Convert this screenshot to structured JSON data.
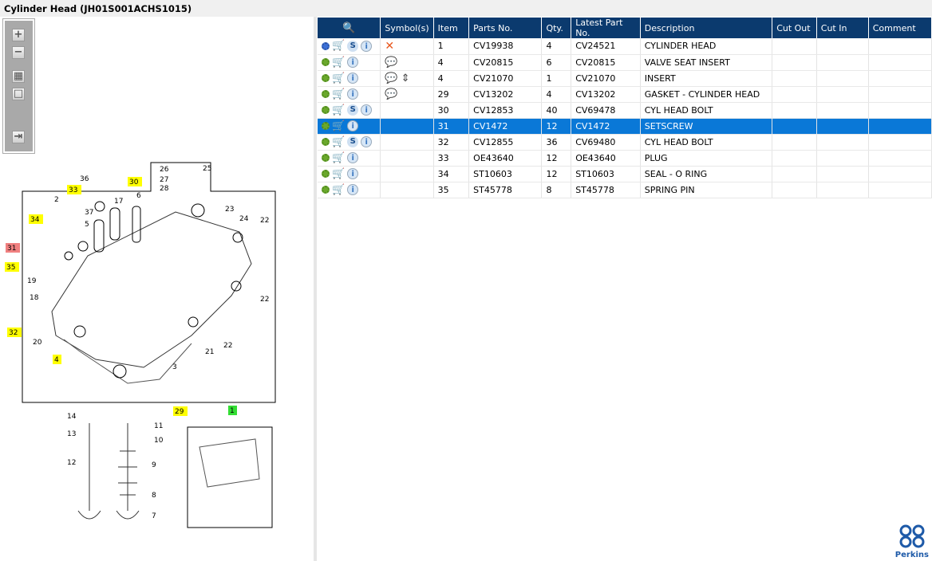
{
  "title": "Cylinder Head (JH01S001ACHS1015)",
  "toolbar": {
    "zoom_in": "+",
    "zoom_out": "−",
    "fit": "▦",
    "actual": "□",
    "export": "⇥"
  },
  "table": {
    "headers": [
      "",
      "Symbol(s)",
      "Item",
      "Parts No.",
      "Qty.",
      "Latest Part No.",
      "Description",
      "Cut Out",
      "Cut In",
      "Comment"
    ],
    "rows": [
      {
        "icons": [
          "gears-blue",
          "cart",
          "S",
          "i"
        ],
        "symbols": "✕",
        "item": "1",
        "part": "CV19938",
        "qty": "4",
        "latest": "CV24521",
        "desc": "CYLINDER HEAD",
        "sel": false
      },
      {
        "icons": [
          "gear",
          "cart",
          "i"
        ],
        "symbols": "💬",
        "item": "4",
        "part": "CV20815",
        "qty": "6",
        "latest": "CV20815",
        "desc": "VALVE SEAT INSERT",
        "sel": false
      },
      {
        "icons": [
          "gear",
          "cart",
          "i"
        ],
        "symbols": "💬 ⇕",
        "item": "4",
        "part": "CV21070",
        "qty": "1",
        "latest": "CV21070",
        "desc": "INSERT",
        "sel": false
      },
      {
        "icons": [
          "gear",
          "cart",
          "i"
        ],
        "symbols": "💬",
        "item": "29",
        "part": "CV13202",
        "qty": "4",
        "latest": "CV13202",
        "desc": "GASKET - CYLINDER HEAD",
        "sel": false
      },
      {
        "icons": [
          "gear",
          "cart",
          "S",
          "i"
        ],
        "symbols": "",
        "item": "30",
        "part": "CV12853",
        "qty": "40",
        "latest": "CV69478",
        "desc": "CYL HEAD BOLT",
        "sel": false
      },
      {
        "icons": [
          "gear",
          "cart",
          "i"
        ],
        "symbols": "",
        "item": "31",
        "part": "CV1472",
        "qty": "12",
        "latest": "CV1472",
        "desc": "SETSCREW",
        "sel": true
      },
      {
        "icons": [
          "gear",
          "cart",
          "S",
          "i"
        ],
        "symbols": "",
        "item": "32",
        "part": "CV12855",
        "qty": "36",
        "latest": "CV69480",
        "desc": "CYL HEAD BOLT",
        "sel": false
      },
      {
        "icons": [
          "gear",
          "cart",
          "i"
        ],
        "symbols": "",
        "item": "33",
        "part": "OE43640",
        "qty": "12",
        "latest": "OE43640",
        "desc": "PLUG",
        "sel": false
      },
      {
        "icons": [
          "gear",
          "cart",
          "i"
        ],
        "symbols": "",
        "item": "34",
        "part": "ST10603",
        "qty": "12",
        "latest": "ST10603",
        "desc": "SEAL - O RING",
        "sel": false
      },
      {
        "icons": [
          "gear",
          "cart",
          "i"
        ],
        "symbols": "",
        "item": "35",
        "part": "ST45778",
        "qty": "8",
        "latest": "ST45778",
        "desc": "SPRING PIN",
        "sel": false
      }
    ]
  },
  "callouts": [
    {
      "t": "36",
      "c": "none"
    },
    {
      "t": "30",
      "c": "#ffff00"
    },
    {
      "t": "26",
      "c": "none"
    },
    {
      "t": "25",
      "c": "none"
    },
    {
      "t": "27",
      "c": "none"
    },
    {
      "t": "28",
      "c": "none"
    },
    {
      "t": "2",
      "c": "none"
    },
    {
      "t": "33",
      "c": "#ffff00"
    },
    {
      "t": "6",
      "c": "none"
    },
    {
      "t": "17",
      "c": "none"
    },
    {
      "t": "37",
      "c": "none"
    },
    {
      "t": "23",
      "c": "none"
    },
    {
      "t": "34",
      "c": "#ffff00"
    },
    {
      "t": "5",
      "c": "none"
    },
    {
      "t": "24",
      "c": "none"
    },
    {
      "t": "22",
      "c": "none"
    },
    {
      "t": "31",
      "c": "#f08080"
    },
    {
      "t": "35",
      "c": "#ffff00"
    },
    {
      "t": "19",
      "c": "none"
    },
    {
      "t": "18",
      "c": "none"
    },
    {
      "t": "22",
      "c": "none"
    },
    {
      "t": "32",
      "c": "#ffff00"
    },
    {
      "t": "20",
      "c": "none"
    },
    {
      "t": "22",
      "c": "none"
    },
    {
      "t": "21",
      "c": "none"
    },
    {
      "t": "4",
      "c": "#ffff00"
    },
    {
      "t": "3",
      "c": "none"
    },
    {
      "t": "29",
      "c": "#ffff00"
    },
    {
      "t": "1",
      "c": "#33dd33"
    },
    {
      "t": "14",
      "c": "none"
    },
    {
      "t": "11",
      "c": "none"
    },
    {
      "t": "13",
      "c": "none"
    },
    {
      "t": "10",
      "c": "none"
    },
    {
      "t": "12",
      "c": "none"
    },
    {
      "t": "9",
      "c": "none"
    },
    {
      "t": "8",
      "c": "none"
    },
    {
      "t": "7",
      "c": "none"
    }
  ],
  "logo": "Perkins"
}
